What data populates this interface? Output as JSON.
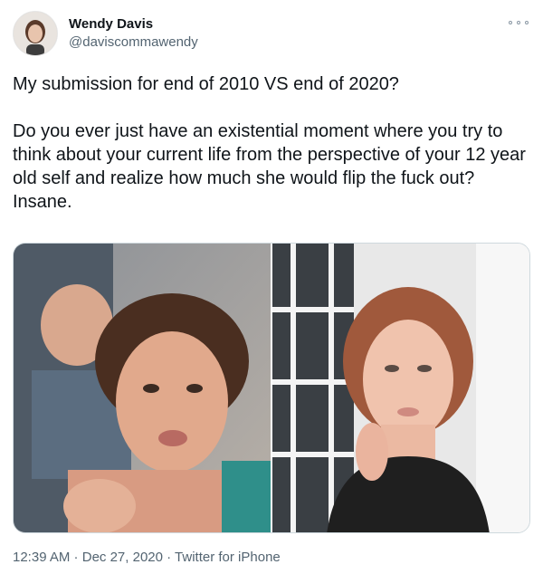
{
  "author": {
    "display_name": "Wendy Davis",
    "handle": "@daviscommawendy",
    "avatar_icon": "profile-photo"
  },
  "tweet": {
    "line1": "My submission for end of 2010 VS end of 2020?",
    "line2": "Do you ever just have an existential moment where you try to think about your current life from the perspective of your 12 year old self and realize how much she would flip the fuck out? Insane."
  },
  "media": {
    "left_photo": "photo-2010",
    "right_photo": "photo-2020"
  },
  "footer": {
    "time": "12:39 AM",
    "separator": " · ",
    "date": "Dec 27, 2020",
    "source": "Twitter for iPhone"
  },
  "colors": {
    "text_primary": "#0f1419",
    "text_secondary": "#536471",
    "border": "#cfd9de"
  }
}
